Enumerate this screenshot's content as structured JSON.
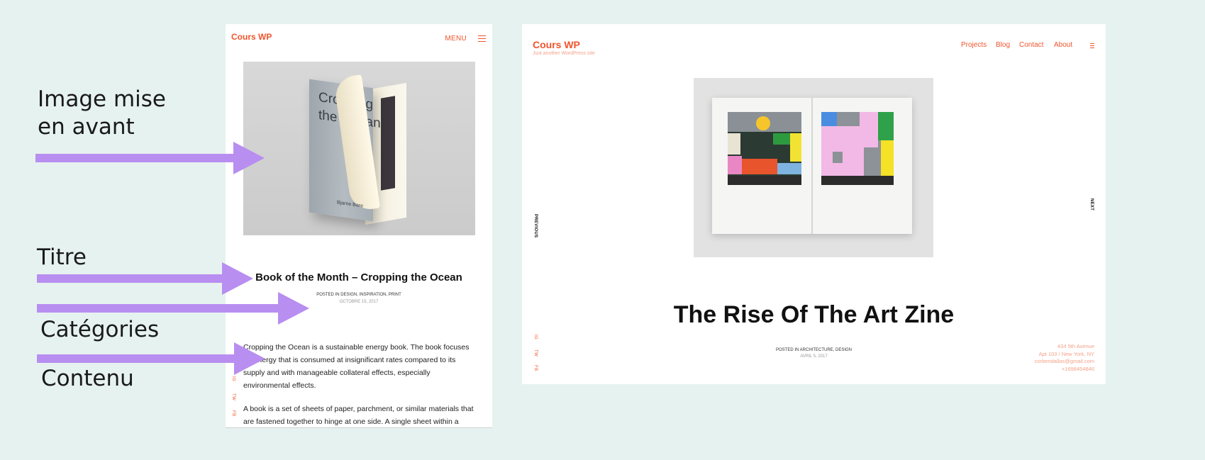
{
  "annotations": {
    "featured_image_line1": "Image mise",
    "featured_image_line2": "en avant",
    "title": "Titre",
    "categories": "Catégories",
    "content": "Contenu",
    "arrow_color": "#b88ef0"
  },
  "mobile": {
    "site_title": "Cours WP",
    "menu_label": "MENU",
    "menu_icon": "hamburger-icon",
    "featured_image": {
      "book_title_line1": "Cropping",
      "book_title_line2": "the Ocean",
      "book_title_flap": "ng",
      "book_author": "Bjarne Bare"
    },
    "post_title": "Book of the Month – Cropping the Ocean",
    "posted_in": "POSTED IN DESIGN, INSPIRATION, PRINT",
    "date": "OCTOBRE 15, 2017",
    "content": [
      "Cropping the Ocean is a sustainable energy book. The book focuses on energy that is consumed at insignificant rates compared to its supply and with manageable collateral effects, especially environmental effects.",
      "A book is a set of sheets of paper, parchment, or similar materials that are fastened together to hinge at one side. A single sheet within a"
    ],
    "social": [
      "IG",
      "TW",
      "FB"
    ]
  },
  "desktop": {
    "site_title": "Cours WP",
    "tagline": "Just another WordPress site",
    "nav": [
      "Projects",
      "Blog",
      "Contact",
      "About"
    ],
    "menu_icon": "hamburger-icon",
    "previous_label": "PREVIOUS",
    "next_label": "NEXT",
    "post_title": "The Rise Of The Art Zine",
    "posted_in": "POSTED IN ARCHITECTURE, DESIGN",
    "date": "AVRIL 5, 2017",
    "social": [
      "IG",
      "TW",
      "FB"
    ],
    "address": [
      "434 5th Avenue",
      "Apt 103 / New York, NY",
      "corbendallas@gmail.com",
      "+1698454846"
    ]
  },
  "colors": {
    "background": "#e6f2ef",
    "accent": "#f0542c",
    "accent_light": "#f4a28a"
  }
}
